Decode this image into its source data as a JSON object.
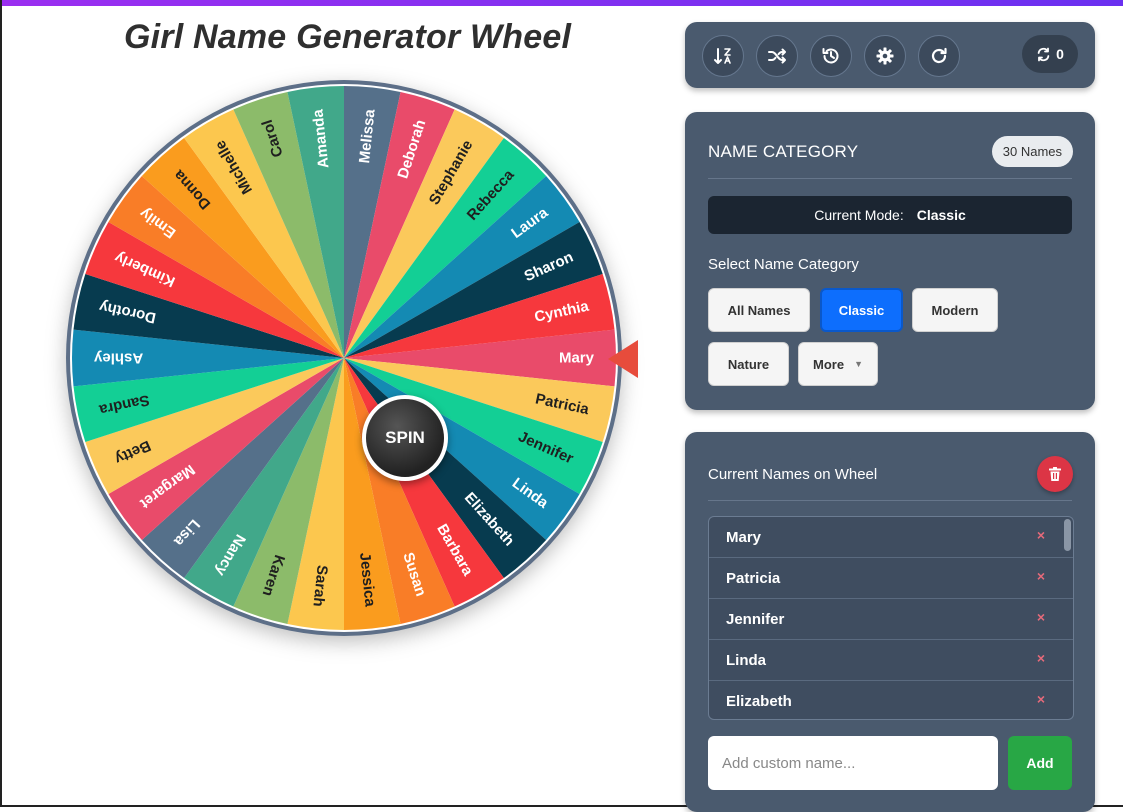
{
  "header": {
    "title": "Girl Name Generator Wheel"
  },
  "wheel": {
    "spin_label": "SPIN",
    "names": [
      "Mary",
      "Patricia",
      "Jennifer",
      "Linda",
      "Elizabeth",
      "Barbara",
      "Susan",
      "Jessica",
      "Sarah",
      "Karen",
      "Nancy",
      "Lisa",
      "Margaret",
      "Betty",
      "Sandra",
      "Ashley",
      "Dorothy",
      "Kimberly",
      "Emily",
      "Donna",
      "Michelle",
      "Carol",
      "Amanda",
      "Melissa",
      "Deborah",
      "Stephanie",
      "Rebecca",
      "Laura",
      "Sharon",
      "Cynthia"
    ],
    "colors": [
      "#e94b6a",
      "#fbc95b",
      "#13cf95",
      "#148ab3",
      "#073b4f",
      "#f6383d",
      "#f97d27",
      "#fa9c1e",
      "#fcc74e",
      "#8cbb6a",
      "#41a88a",
      "#55708a",
      "#e94b6a",
      "#fbc95b",
      "#13cf95",
      "#148ab3",
      "#073b4f",
      "#f6383d",
      "#f97d27",
      "#fa9c1e",
      "#fcc74e",
      "#8cbb6a",
      "#41a88a",
      "#55708a",
      "#e94b6a",
      "#fbc95b",
      "#13cf95",
      "#148ab3",
      "#073b4f",
      "#f6383d"
    ],
    "dark_text_colors": [
      "#fbc95b",
      "#13cf95",
      "#fa9c1e",
      "#fcc74e",
      "#8cbb6a"
    ]
  },
  "toolbar": {
    "icons": [
      "sort-icon",
      "shuffle-icon",
      "history-icon",
      "gear-icon",
      "refresh-icon"
    ],
    "spin_count": "0"
  },
  "category": {
    "title": "NAME CATEGORY",
    "count_badge": "30 Names",
    "mode_label": "Current Mode:",
    "mode_value": "Classic",
    "select_label": "Select Name Category",
    "buttons": {
      "all": "All Names",
      "classic": "Classic",
      "modern": "Modern",
      "nature": "Nature",
      "more": "More"
    },
    "active": "Classic"
  },
  "names_panel": {
    "title": "Current Names on Wheel",
    "visible_names": [
      "Mary",
      "Patricia",
      "Jennifer",
      "Linda",
      "Elizabeth"
    ],
    "remove_symbol": "×",
    "add_placeholder": "Add custom name...",
    "add_label": "Add"
  },
  "colors": {
    "accent": "#0d6efd",
    "add": "#28a745",
    "danger": "#dc3545",
    "panel": "#4a5a6e",
    "pointer": "#e74c3c"
  }
}
